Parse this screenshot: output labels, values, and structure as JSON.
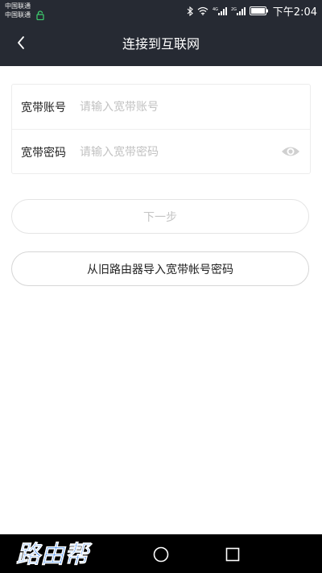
{
  "status_bar": {
    "carrier_1": "中国联通",
    "carrier_2": "中国联通",
    "time": "下午2:04"
  },
  "header": {
    "title": "连接到互联网"
  },
  "form": {
    "account_label": "宽带账号",
    "account_placeholder": "请输入宽带账号",
    "account_value": "",
    "password_label": "宽带密码",
    "password_placeholder": "请输入宽带密码",
    "password_value": ""
  },
  "actions": {
    "next_label": "下一步",
    "import_label": "从旧路由器导入宽带帐号密码"
  },
  "watermark": {
    "text": "路由帮"
  },
  "colors": {
    "header_bg": "#262a33",
    "watermark": "#2f7ff0",
    "disabled_text": "#c4c4c4"
  }
}
